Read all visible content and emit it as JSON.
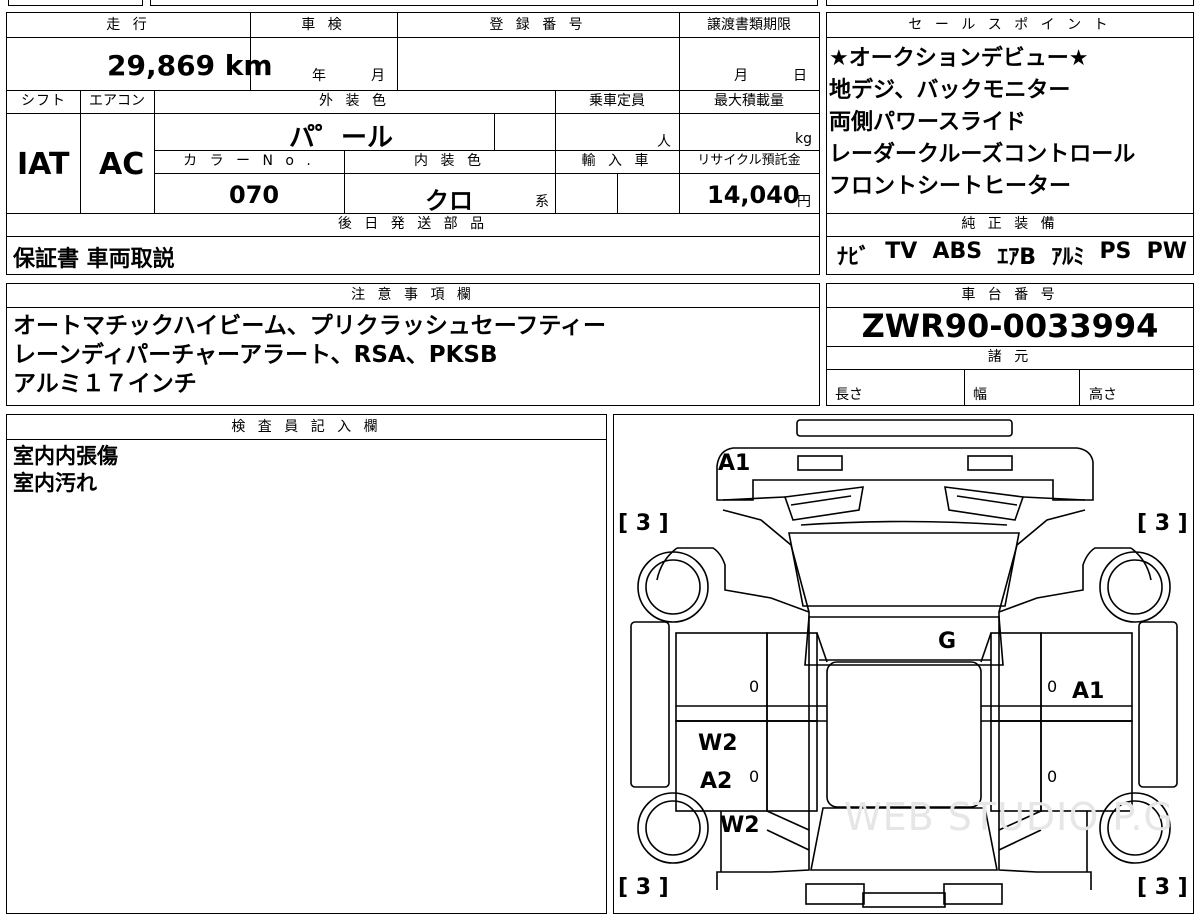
{
  "header": {
    "mileage_label": "走 行",
    "shaken_label": "車 検",
    "reg_label": "登 録 番 号",
    "transfer_label": "譲渡書類期限",
    "sales_label": "セ ー ル ス ポ イ ン ト",
    "shift_label": "シフト",
    "ac_label": "エアコン",
    "exterior_label": "外 装 色",
    "capacity_label": "乗車定員",
    "maxload_label": "最大積載量",
    "colorno_label": "カ ラ ー N o .",
    "interior_label": "内 装 色",
    "import_label": "輸 入 車",
    "recycle_label": "リサイクル預託金",
    "later_label": "後 日 発 送 部 品",
    "genuine_label": "純 正 装 備",
    "notes_label": "注 意 事 項 欄",
    "chassis_label": "車 台 番 号",
    "specs_label": "諸 元",
    "inspector_label": "検 査 員 記 入 欄"
  },
  "values": {
    "mileage": "29,869 km",
    "shaken_year": "年",
    "shaken_month": "月",
    "transfer_month": "月",
    "transfer_day": "日",
    "shift": "IAT",
    "ac": "AC",
    "exterior_color": "パ゜ール",
    "capacity_unit": "人",
    "maxload_unit": "kg",
    "color_no": "070",
    "interior_color": "クロ",
    "interior_suffix": "系",
    "recycle_fee": "14,040",
    "recycle_unit": "円",
    "chassis_no": "ZWR90-0033994",
    "spec_length": "長さ",
    "spec_width": "幅",
    "spec_height": "高さ"
  },
  "sales_points": [
    "★オークションデビュー★",
    "地デジ、バックモニター",
    "両側パワースライド",
    "レーダークルーズコントロール",
    "フロントシートヒーター"
  ],
  "later_parts": "保証書 車両取説",
  "genuine_equipment": [
    "ﾅﾋﾞ",
    "TV",
    "ABS",
    "ｴｱB",
    "ｱﾙﾐ",
    "PS",
    "PW"
  ],
  "notes": [
    "オートマチックハイビーム、プリクラッシュセーフティー",
    "レーンディパーチャーアラート、RSA、PKSB",
    "アルミ１７インチ"
  ],
  "inspector_notes": [
    "室内内張傷",
    "室内汚れ"
  ],
  "diagram": {
    "grades": [
      "[ 3 ]",
      "[ 3 ]",
      "[ 3 ]",
      "[ 3 ]"
    ],
    "marks": [
      "A1",
      "G",
      "A1",
      "W2",
      "A2",
      "W2"
    ],
    "zeros": [
      "0",
      "0",
      "0",
      "0"
    ],
    "watermark": "WEB STUDIO P.G"
  }
}
